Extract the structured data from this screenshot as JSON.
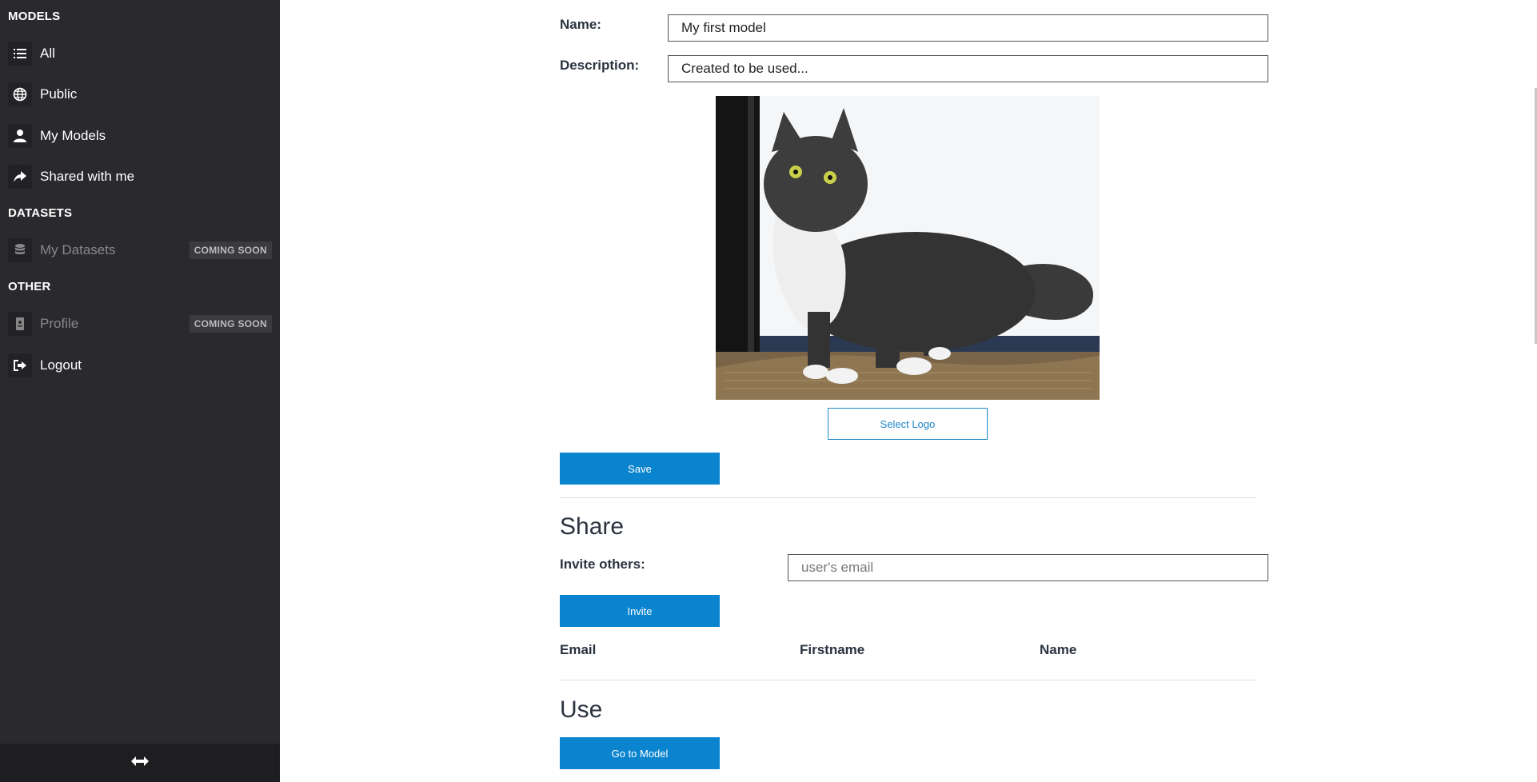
{
  "sidebar": {
    "sections": {
      "models": "MODELS",
      "datasets": "DATASETS",
      "other": "OTHER"
    },
    "items": {
      "all": {
        "label": "All",
        "icon": "list-icon"
      },
      "public": {
        "label": "Public",
        "icon": "globe-icon"
      },
      "my_models": {
        "label": "My Models",
        "icon": "user-icon"
      },
      "shared": {
        "label": "Shared with me",
        "icon": "share-icon"
      },
      "my_datasets": {
        "label": "My Datasets",
        "icon": "database-icon",
        "badge": "COMING SOON"
      },
      "profile": {
        "label": "Profile",
        "icon": "id-card-icon",
        "badge": "COMING SOON"
      },
      "logout": {
        "label": "Logout",
        "icon": "sign-out-icon"
      }
    },
    "footer_icon": "resize-arrows-icon"
  },
  "form": {
    "name_label": "Name:",
    "name_value": "My first model",
    "description_label": "Description:",
    "description_value": "Created to be used...",
    "select_logo_label": "Select Logo",
    "save_label": "Save"
  },
  "share": {
    "heading": "Share",
    "invite_label": "Invite others:",
    "email_placeholder": "user's email",
    "invite_button": "Invite",
    "columns": [
      "Email",
      "Firstname",
      "Name"
    ]
  },
  "use": {
    "heading": "Use",
    "go_button": "Go to Model"
  },
  "colors": {
    "sidebar_bg": "#2a2a2e",
    "primary": "#0b84cf",
    "heading_text": "#2b3340"
  }
}
